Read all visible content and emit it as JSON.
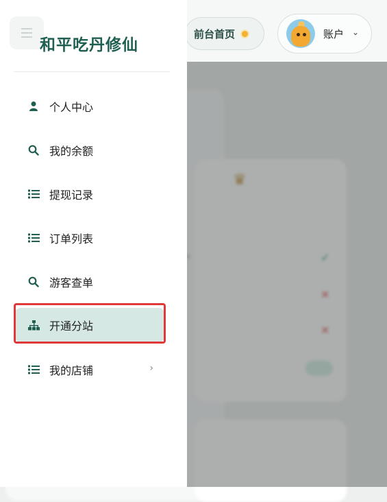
{
  "header": {
    "home_label": "前台首页",
    "account_label": "账户",
    "account_caret": "⌄"
  },
  "sidebar": {
    "brand": "和平吃丹修仙",
    "items": [
      {
        "label": "个人中心",
        "icon": "person-icon"
      },
      {
        "label": "我的余额",
        "icon": "search-icon"
      },
      {
        "label": "提现记录",
        "icon": "list-icon"
      },
      {
        "label": "订单列表",
        "icon": "list-icon"
      },
      {
        "label": "游客查单",
        "icon": "search-icon"
      },
      {
        "label": "开通分站",
        "icon": "sitemap-icon",
        "active": true
      },
      {
        "label": "我的店铺",
        "icon": "list-icon",
        "has_submenu": true
      }
    ]
  },
  "colors": {
    "accent": "#1e5f52",
    "active_bg": "#d5e8e3",
    "highlight_border": "#e0393b"
  }
}
